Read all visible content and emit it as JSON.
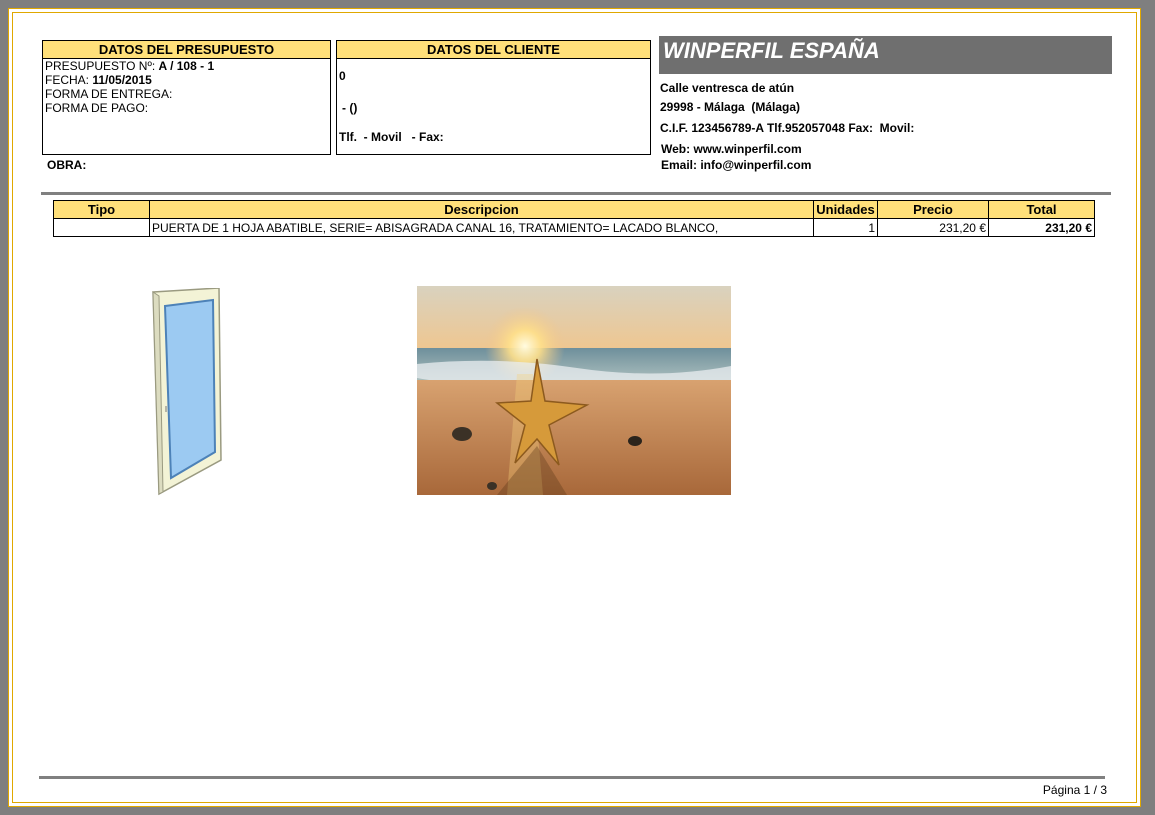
{
  "presupuesto": {
    "header": "DATOS DEL PRESUPUESTO",
    "numero_label": "PRESUPUESTO Nº:",
    "numero_value": "A / 108 - 1",
    "fecha_label": "FECHA:",
    "fecha_value": "11/05/2015",
    "entrega_label": "FORMA DE ENTREGA:",
    "pago_label": "FORMA DE PAGO:",
    "obra_label": "OBRA:"
  },
  "cliente": {
    "header": "DATOS DEL CLIENTE",
    "line1": "0",
    "line2": "-  ()",
    "line3": "Tlf.  - Movil   - Fax:"
  },
  "empresa": {
    "name": "WINPERFIL ESPAÑA",
    "address": "Calle ventresca de atún",
    "city": "29998 - Málaga  (Málaga)",
    "cif": "C.I.F. 123456789-A Tlf.952057048 Fax:  Movil:",
    "web": "Web: www.winperfil.com",
    "email": "Email: info@winperfil.com"
  },
  "table": {
    "headers": [
      "Tipo",
      "Descripcion",
      "Unidades",
      "Precio",
      "Total"
    ],
    "rows": [
      {
        "tipo": "",
        "descripcion": "PUERTA DE 1 HOJA ABATIBLE, SERIE= ABISAGRADA CANAL 16,  TRATAMIENTO=  LACADO BLANCO,",
        "unidades": "1",
        "precio": "231,20 €",
        "total": "231,20 €"
      }
    ]
  },
  "footer": {
    "page_label": "Página",
    "page_value": "1 / 3"
  },
  "colors": {
    "header_fill": "#ffe07a",
    "banner_fill": "#6f6f6f",
    "page_border": "#e0a800"
  }
}
